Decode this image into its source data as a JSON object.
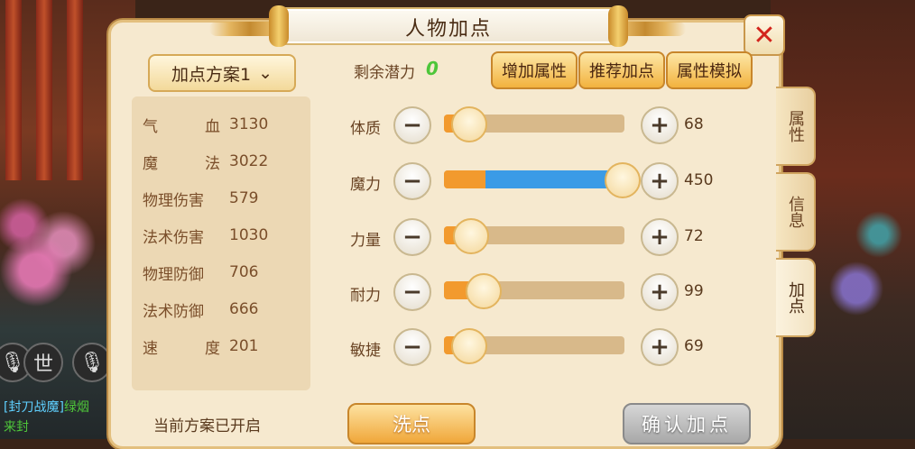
{
  "window": {
    "title": "人物加点",
    "close_icon": "close-icon"
  },
  "plan": {
    "dropdown_label": "加点方案1",
    "status": "当前方案已开启"
  },
  "stats": [
    {
      "label_chars": [
        "气",
        "血"
      ],
      "value": "3130"
    },
    {
      "label_chars": [
        "魔",
        "法"
      ],
      "value": "3022"
    },
    {
      "label_chars": [
        "物理伤害"
      ],
      "value": "579"
    },
    {
      "label_chars": [
        "法术伤害"
      ],
      "value": "1030"
    },
    {
      "label_chars": [
        "物理防御"
      ],
      "value": "706"
    },
    {
      "label_chars": [
        "法术防御"
      ],
      "value": "666"
    },
    {
      "label_chars": [
        "速",
        "度"
      ],
      "value": "201"
    }
  ],
  "potential": {
    "label": "剩余潜力",
    "value": "0"
  },
  "top_buttons": [
    "增加属性",
    "推荐加点",
    "属性模拟"
  ],
  "attributes": [
    {
      "label": "体质",
      "value": "68",
      "base_fraction": 0.13,
      "added_fraction": 0.0
    },
    {
      "label": "魔力",
      "value": "450",
      "base_fraction": 0.23,
      "added_fraction": 0.75
    },
    {
      "label": "力量",
      "value": "72",
      "base_fraction": 0.14,
      "added_fraction": 0.0
    },
    {
      "label": "耐力",
      "value": "99",
      "base_fraction": 0.21,
      "added_fraction": 0.0
    },
    {
      "label": "敏捷",
      "value": "69",
      "base_fraction": 0.13,
      "added_fraction": 0.0
    }
  ],
  "bottom_buttons": {
    "wash": "洗点",
    "confirm": "确认加点"
  },
  "side_tabs": [
    "属性",
    "信息",
    "加点"
  ],
  "active_side_tab": "加点",
  "background": {
    "voice_label": "世",
    "chat_lines": [
      {
        "text": "[封刀战魔]",
        "color": "#5fd0ff"
      },
      {
        "text": "绿烟",
        "color": "#4ec63a"
      },
      {
        "text": "来封",
        "color": "#4ec63a"
      }
    ]
  },
  "colors": {
    "base_fill": "#f29a2e",
    "added_fill": "#3b9be6",
    "potential": "#4ec63a",
    "close": "#d3241c"
  }
}
